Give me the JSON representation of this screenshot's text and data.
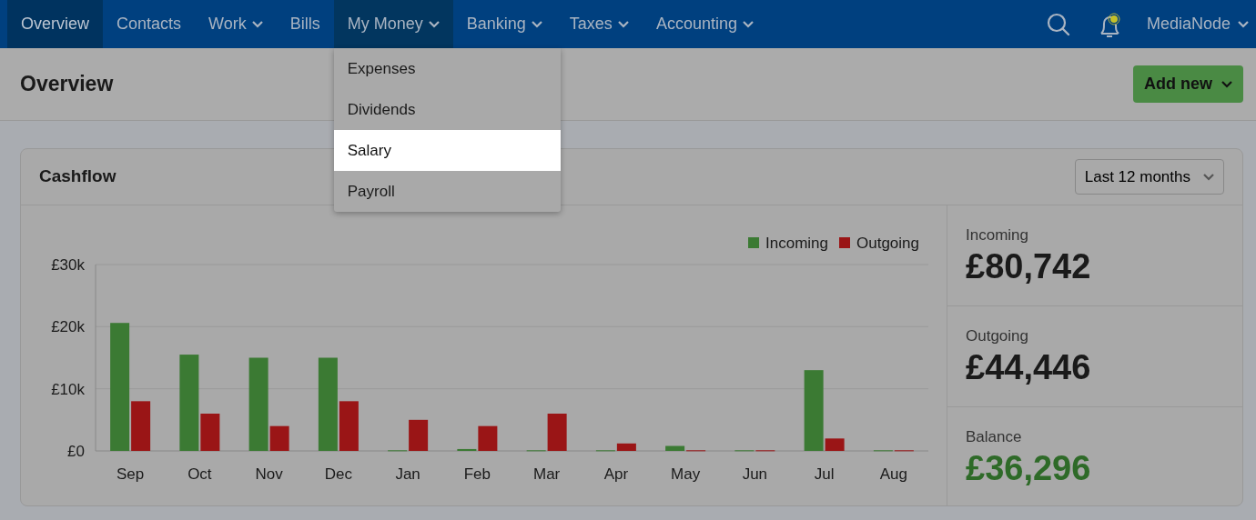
{
  "nav": {
    "items": [
      {
        "label": "Overview",
        "dropdown": false,
        "selected": true
      },
      {
        "label": "Contacts",
        "dropdown": false,
        "selected": false
      },
      {
        "label": "Work",
        "dropdown": true,
        "selected": false
      },
      {
        "label": "Bills",
        "dropdown": false,
        "selected": false
      },
      {
        "label": "My Money",
        "dropdown": true,
        "selected": false,
        "expanded": true
      },
      {
        "label": "Banking",
        "dropdown": true,
        "selected": false
      },
      {
        "label": "Taxes",
        "dropdown": true,
        "selected": false
      },
      {
        "label": "Accounting",
        "dropdown": true,
        "selected": false
      }
    ],
    "notification": true,
    "user": "MediaNode"
  },
  "menu": {
    "items": [
      {
        "label": "Expenses",
        "selected": false
      },
      {
        "label": "Dividends",
        "selected": false
      },
      {
        "label": "Salary",
        "selected": true
      },
      {
        "label": "Payroll",
        "selected": false
      }
    ]
  },
  "page_title": "Overview",
  "add_button": "Add new",
  "cashflow": {
    "title": "Cashflow",
    "period": "Last 12 months",
    "chart_data": {
      "type": "bar",
      "legend": true,
      "categories": [
        "Sep",
        "Oct",
        "Nov",
        "Dec",
        "Jan",
        "Feb",
        "Mar",
        "Apr",
        "May",
        "Jun",
        "Jul",
        "Aug"
      ],
      "ylim": [
        0,
        30000
      ],
      "yticks": [
        {
          "value": 0,
          "label": "£0"
        },
        {
          "value": 10000,
          "label": "£10k"
        },
        {
          "value": 20000,
          "label": "£20k"
        },
        {
          "value": 30000,
          "label": "£30k"
        }
      ],
      "series": [
        {
          "name": "Incoming",
          "color": "#3b7a33",
          "values": [
            20600,
            15500,
            15000,
            15000,
            100,
            300,
            100,
            100,
            800,
            100,
            13000,
            100
          ]
        },
        {
          "name": "Outgoing",
          "color": "#9a1516",
          "values": [
            8000,
            6000,
            4000,
            8000,
            5000,
            4000,
            6000,
            1200,
            100,
            100,
            2000,
            100
          ]
        }
      ]
    },
    "stats": [
      {
        "label": "Incoming",
        "value": "£80,742",
        "kind": "plain"
      },
      {
        "label": "Outgoing",
        "value": "£44,446",
        "kind": "plain"
      },
      {
        "label": "Balance",
        "value": "£36,296",
        "kind": "positive"
      }
    ]
  }
}
